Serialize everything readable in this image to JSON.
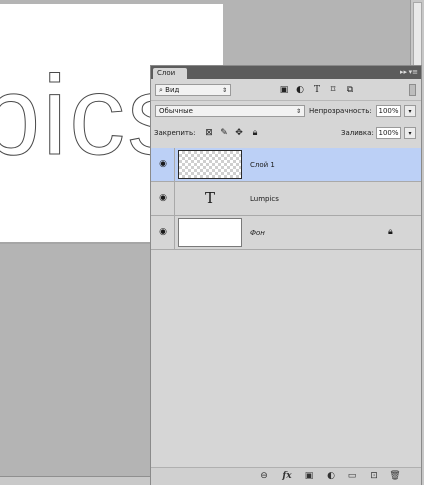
{
  "canvas": {
    "text": "pics"
  },
  "panel": {
    "tab_label": "Слои",
    "collapse_icon": "double-arrow-right-icon",
    "menu_icon": "panel-menu-icon",
    "filter": {
      "icon": "search-icon",
      "value": "Вид",
      "icons": [
        "pixel-filter-icon",
        "adjustment-filter-icon",
        "type-filter-icon",
        "shape-filter-icon",
        "smart-object-filter-icon"
      ]
    },
    "blend": {
      "value": "Обычные",
      "opacity_label": "Непрозрачность:",
      "opacity_value": "100%"
    },
    "lock": {
      "label": "Закрепить:",
      "icons": [
        "lock-transparent-icon",
        "lock-image-icon",
        "lock-position-icon",
        "lock-all-icon"
      ],
      "fill_label": "Заливка:",
      "fill_value": "100%"
    },
    "layers": [
      {
        "name": "Слой 1",
        "selected": true,
        "thumbnail": "transparent",
        "visible": true
      },
      {
        "name": "Lumpics",
        "selected": false,
        "thumbnail": "text",
        "visible": true
      },
      {
        "name": "Фон",
        "selected": false,
        "thumbnail": "white",
        "visible": true,
        "locked": true
      }
    ],
    "footer_icons": [
      "link-icon",
      "fx-icon",
      "mask-icon",
      "adjustment-icon",
      "folder-icon",
      "new-layer-icon",
      "trash-icon"
    ],
    "colors": {
      "selected_row": "#bcd0f6",
      "panel_bg": "#d6d6d6",
      "titlebar": "#5c5c5c"
    }
  }
}
